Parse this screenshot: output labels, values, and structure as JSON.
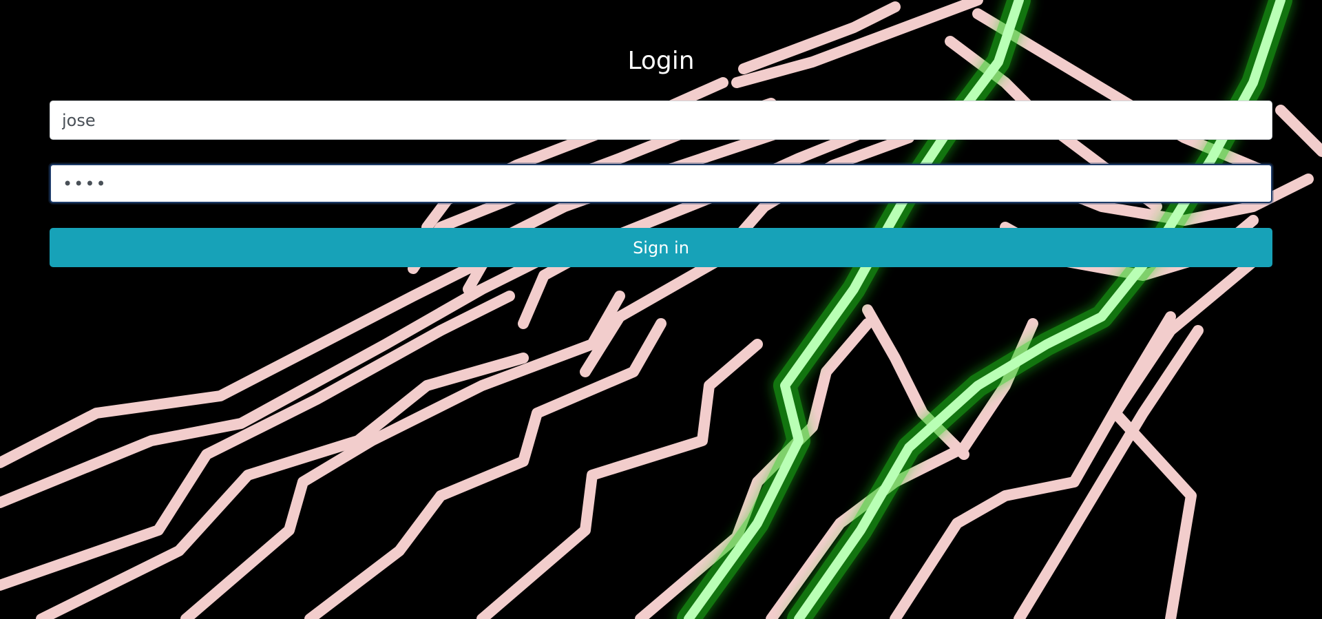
{
  "colors": {
    "background": "#000000",
    "trace_pink": "#f2cdcc",
    "trace_green": "#7dff7a",
    "glow_green": "#21d41e",
    "button": "#17a2b8",
    "focus_border": "#1d3b68"
  },
  "login": {
    "title": "Login",
    "username_value": "jose",
    "password_value": "jose",
    "signin_label": "Sign in"
  }
}
